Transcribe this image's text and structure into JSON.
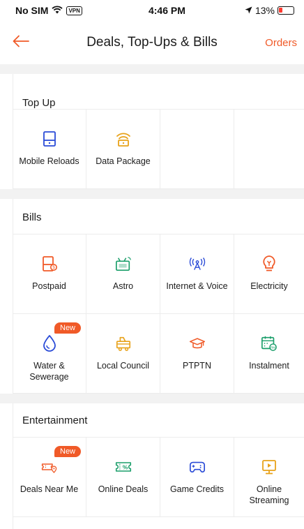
{
  "status": {
    "carrier": "No SIM",
    "vpn": "VPN",
    "time": "4:46 PM",
    "battery": "13%"
  },
  "header": {
    "title": "Deals, Top-Ups & Bills",
    "orders": "Orders"
  },
  "sections": {
    "topup": {
      "title": "Top Up",
      "items": [
        {
          "label": "Mobile Reloads",
          "icon": "mobile-icon"
        },
        {
          "label": "Data Package",
          "icon": "wifi-icon"
        }
      ]
    },
    "bills": {
      "title": "Bills",
      "items": [
        {
          "label": "Postpaid",
          "icon": "postpaid-icon"
        },
        {
          "label": "Astro",
          "icon": "tv-icon"
        },
        {
          "label": "Internet & Voice",
          "icon": "antenna-icon"
        },
        {
          "label": "Electricity",
          "icon": "lightbulb-icon"
        },
        {
          "label": "Water & Sewerage",
          "icon": "water-drop-icon",
          "badge": "New"
        },
        {
          "label": "Local Council",
          "icon": "council-icon"
        },
        {
          "label": "PTPTN",
          "icon": "graduation-cap-icon"
        },
        {
          "label": "Instalment",
          "icon": "calendar-icon"
        }
      ]
    },
    "entertainment": {
      "title": "Entertainment",
      "items": [
        {
          "label": "Deals Near Me",
          "icon": "ticket-location-icon",
          "badge": "New"
        },
        {
          "label": "Online Deals",
          "icon": "percent-ticket-icon"
        },
        {
          "label": "Game Credits",
          "icon": "gamepad-icon"
        },
        {
          "label": "Online Streaming",
          "icon": "play-screen-icon"
        }
      ]
    }
  },
  "colors": {
    "accent": "#f05a28",
    "blue": "#2a4bd7",
    "gold": "#e8a21a",
    "divider": "#ececec",
    "gap": "#f2f2f2"
  }
}
